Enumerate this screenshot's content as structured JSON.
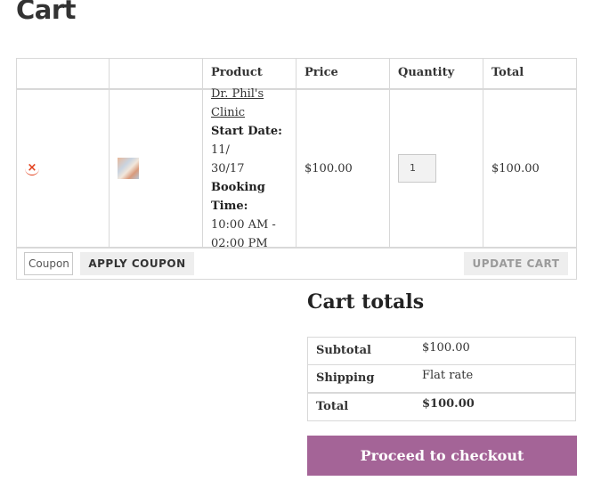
{
  "page": {
    "title": "Cart"
  },
  "cart": {
    "headers": {
      "remove": "",
      "thumbnail": "",
      "product": "Product",
      "price": "Price",
      "quantity": "Quantity",
      "total": "Total"
    },
    "items": [
      {
        "remove_icon": "×",
        "name_line1": "Dr. Phil's",
        "name_line2": "Clinic",
        "start_date_label": "Start Date:",
        "start_date_value_1": "11/",
        "start_date_value_2": "30/17",
        "booking_label_1": "Booking",
        "booking_label_2": "Time:",
        "booking_value_1": "10:00 AM -",
        "booking_value_2": "02:00 PM",
        "price": "$100.00",
        "quantity": "1",
        "total": "$100.00"
      }
    ],
    "actions": {
      "coupon_placeholder": "Coupon",
      "apply_coupon": "APPLY COUPON",
      "update_cart": "UPDATE CART"
    }
  },
  "totals": {
    "title": "Cart totals",
    "rows": [
      {
        "label": "Subtotal",
        "value": "$100.00"
      },
      {
        "label": "Shipping",
        "value": "Flat rate"
      },
      {
        "label": "Total",
        "value": "$100.00"
      }
    ],
    "checkout": "Proceed to checkout"
  },
  "colors": {
    "checkout_bg": "#a46497",
    "remove_icon": "#e2401c"
  }
}
